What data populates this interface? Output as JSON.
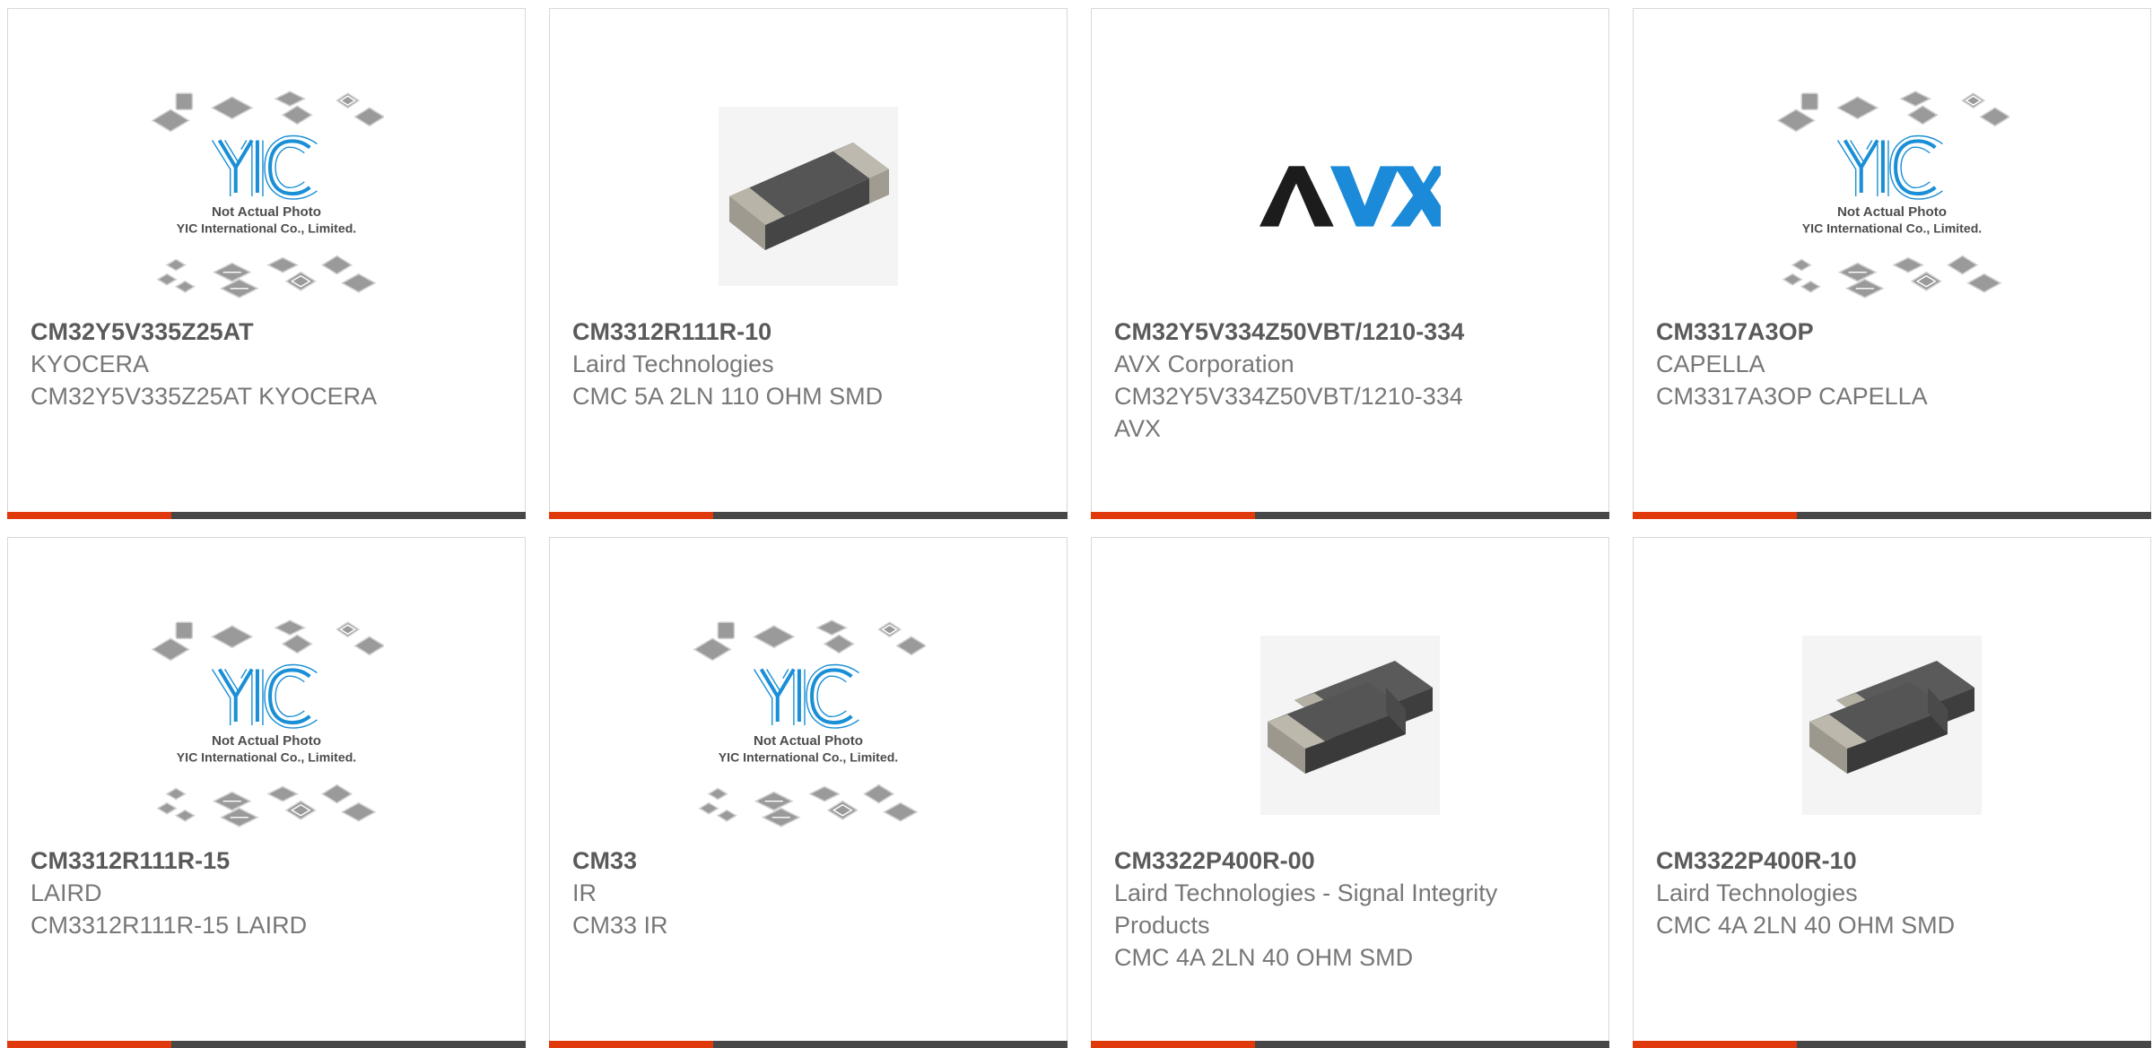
{
  "products": [
    {
      "image": "placeholder",
      "part_number": "CM32Y5V335Z25AT",
      "manufacturer": "KYOCERA",
      "description": "CM32Y5V335Z25AT KYOCERA",
      "description2": ""
    },
    {
      "image": "single-choke",
      "part_number": "CM3312R111R-10",
      "manufacturer": "Laird Technologies",
      "description": "CMC 5A 2LN 110 OHM SMD",
      "description2": ""
    },
    {
      "image": "avx-logo",
      "part_number": "CM32Y5V334Z50VBT/1210-334",
      "manufacturer": "AVX Corporation",
      "description": "CM32Y5V334Z50VBT/1210-334",
      "description2": "AVX"
    },
    {
      "image": "placeholder",
      "part_number": "CM3317A3OP",
      "manufacturer": "CAPELLA",
      "description": "CM3317A3OP CAPELLA",
      "description2": ""
    },
    {
      "image": "placeholder",
      "part_number": "CM3312R111R-15",
      "manufacturer": "LAIRD",
      "description": "CM3312R111R-15 LAIRD",
      "description2": ""
    },
    {
      "image": "placeholder",
      "part_number": "CM33",
      "manufacturer": "IR",
      "description": "CM33 IR",
      "description2": ""
    },
    {
      "image": "double-choke",
      "part_number": "CM3322P400R-00",
      "manufacturer": "Laird Technologies - Signal Integrity Products",
      "description": "CMC 4A 2LN 40 OHM SMD",
      "description2": ""
    },
    {
      "image": "double-choke",
      "part_number": "CM3322P400R-10",
      "manufacturer": "Laird Technologies",
      "description": "CMC 4A 2LN 40 OHM SMD",
      "description2": ""
    }
  ],
  "placeholder": {
    "logo_text": "YIC",
    "line1": "Not Actual Photo",
    "line2": "YIC International Co., Limited."
  },
  "avx_logo_text": "AVX",
  "colors": {
    "accent": "#e0390b",
    "bar": "#474747",
    "yic_blue": "#1a8fd6",
    "avx_blue": "#1b8ad8",
    "avx_dark": "#1c1c1c"
  }
}
